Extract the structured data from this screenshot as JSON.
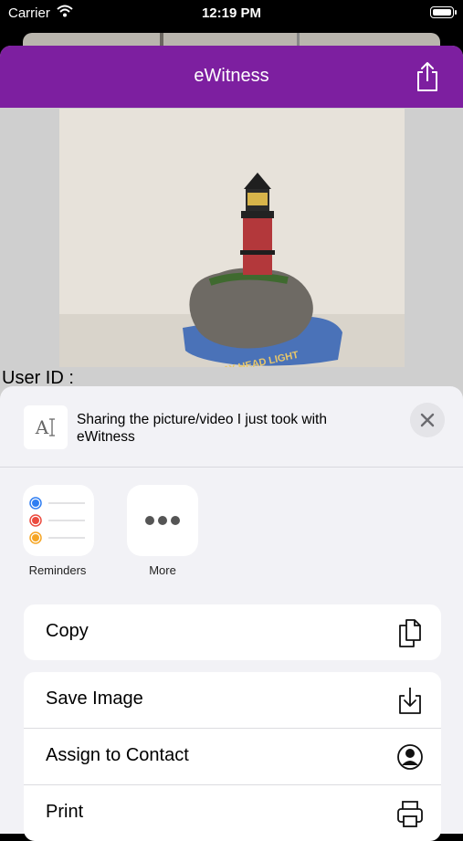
{
  "status_bar": {
    "carrier": "Carrier",
    "time": "12:19 PM"
  },
  "app": {
    "title": "eWitness",
    "header_color": "#7d1fa0",
    "photo_text": "GAY HEAD LIGHT",
    "user_id_label": "User ID :"
  },
  "share_sheet": {
    "preview_glyph": "A",
    "message": "Sharing the picture/video I just took with eWitness",
    "apps": [
      {
        "label": "Reminders",
        "icon": "reminders-icon"
      },
      {
        "label": "More",
        "icon": "more-icon"
      }
    ],
    "actions": {
      "copy": {
        "label": "Copy",
        "icon": "copy-icon"
      },
      "save_image": {
        "label": "Save Image",
        "icon": "save-icon"
      },
      "assign_contact": {
        "label": "Assign to Contact",
        "icon": "contact-icon"
      },
      "print": {
        "label": "Print",
        "icon": "printer-icon"
      }
    }
  }
}
